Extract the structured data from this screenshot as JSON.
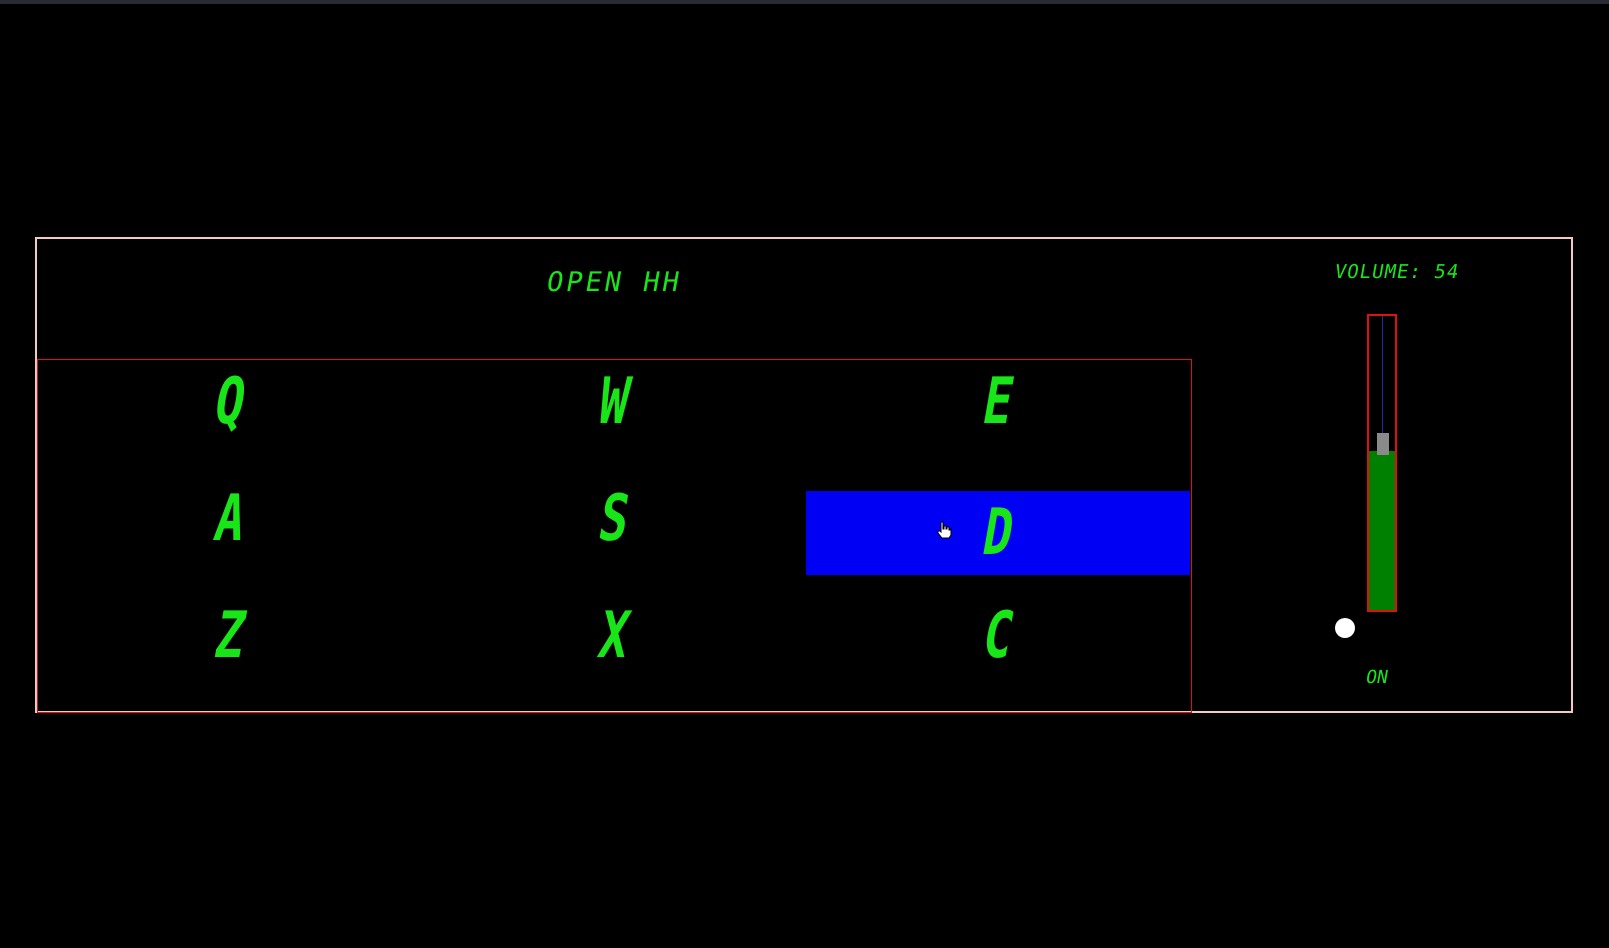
{
  "title": "OPEN HH",
  "keys": [
    {
      "label": "Q"
    },
    {
      "label": "W"
    },
    {
      "label": "E"
    },
    {
      "label": "A"
    },
    {
      "label": "S"
    },
    {
      "label": "D"
    },
    {
      "label": "Z"
    },
    {
      "label": "X"
    },
    {
      "label": "C"
    }
  ],
  "active_key": "D",
  "volume": {
    "label": "VOLUME: 54",
    "level": 0.54
  },
  "power": {
    "label": "ON"
  },
  "colors": {
    "segment": "#19e619",
    "active": "#0000f5",
    "fill": "#008000",
    "border": "#e01010",
    "frame": "#f4c8c8"
  }
}
